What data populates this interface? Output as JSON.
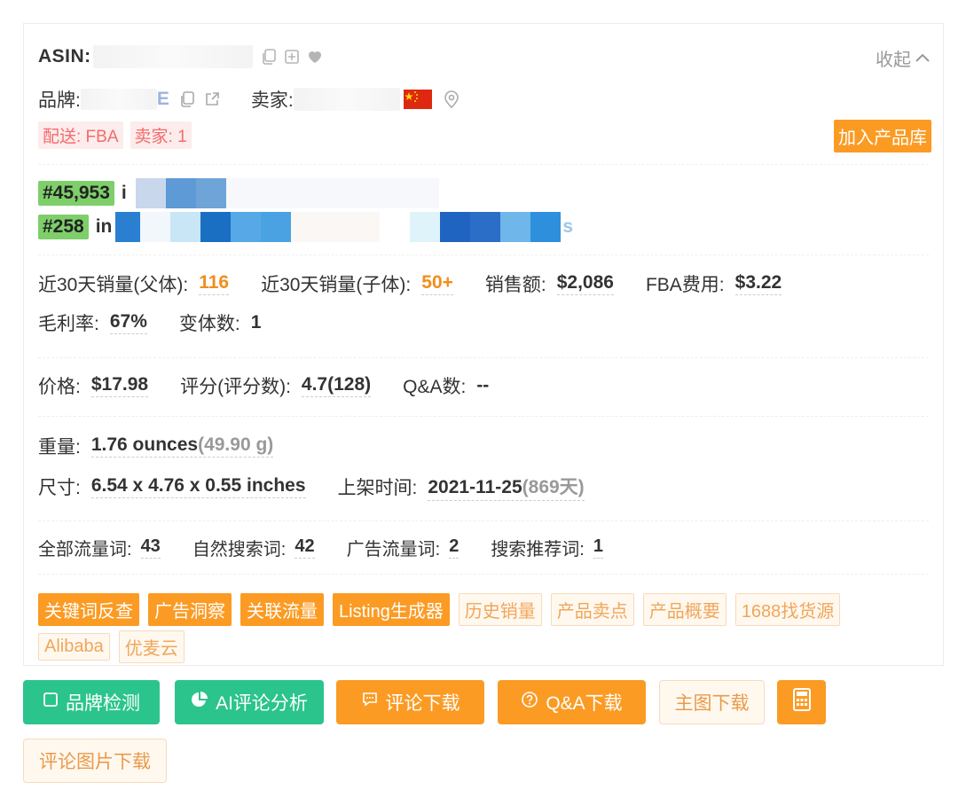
{
  "card": {
    "asin_label": "ASIN:",
    "collapse_label": "收起",
    "brand_label": "品牌:",
    "brand_value_fragment": "E",
    "seller_label": "卖家:",
    "delivery_tag": "配送: FBA",
    "seller_count_tag": "卖家: 1",
    "add_to_library": "加入产品库",
    "rank1": {
      "badge": "#45,953",
      "prefix": "i"
    },
    "rank2": {
      "badge": "#258",
      "prefix": "in",
      "suffix": "s"
    },
    "stats1": [
      {
        "label": "近30天销量(父体):",
        "value": "116",
        "accent": true
      },
      {
        "label": "近30天销量(子体):",
        "value": "50+",
        "accent": true
      },
      {
        "label": "销售额:",
        "value": "$2,086",
        "accent": false
      },
      {
        "label": "FBA费用:",
        "value": "$3.22",
        "accent": false
      }
    ],
    "stats2": [
      {
        "label": "毛利率:",
        "value": "67%"
      },
      {
        "label": "变体数:",
        "value": "1"
      }
    ],
    "price_row": [
      {
        "label": "价格:",
        "value": "$17.98"
      },
      {
        "label": "评分(评分数):",
        "value": "4.7(128)"
      },
      {
        "label": "Q&A数:",
        "value": "--"
      }
    ],
    "weight": {
      "label": "重量:",
      "value": "1.76 ounces",
      "extra": "(49.90 g)"
    },
    "size": {
      "label": "尺寸:",
      "value": "6.54 x 4.76 x 0.55 inches"
    },
    "listed": {
      "label": "上架时间:",
      "value": "2021-11-25",
      "extra_open": "(869",
      "extra_days": "天",
      "extra_close": ")"
    },
    "traffic": [
      {
        "label": "全部流量词:",
        "value": "43"
      },
      {
        "label": "自然搜索词:",
        "value": "42"
      },
      {
        "label": "广告流量词:",
        "value": "2"
      },
      {
        "label": "搜索推荐词:",
        "value": "1"
      }
    ],
    "tags_row1": [
      {
        "label": "关键词反查",
        "solid": true
      },
      {
        "label": "广告洞察",
        "solid": true
      },
      {
        "label": "关联流量",
        "solid": true
      },
      {
        "label": "Listing生成器",
        "solid": true
      },
      {
        "label": "历史销量",
        "solid": false
      },
      {
        "label": "产品卖点",
        "solid": false
      },
      {
        "label": "产品概要",
        "solid": false
      },
      {
        "label": "1688找货源",
        "solid": false
      }
    ],
    "tags_row2": [
      {
        "label": "Alibaba",
        "solid": false
      },
      {
        "label": "优麦云",
        "solid": false
      }
    ]
  },
  "actions": {
    "brand_check": "品牌检测",
    "ai_review": "AI评论分析",
    "review_download": "评论下载",
    "qa_download": "Q&A下载",
    "main_image_download": "主图下载",
    "review_image_download": "评论图片下载"
  },
  "colors": {
    "accent": "#fb9b24",
    "green": "#2bc48d",
    "rank_badge": "#7ecf6a",
    "danger": "#f36c6c"
  }
}
